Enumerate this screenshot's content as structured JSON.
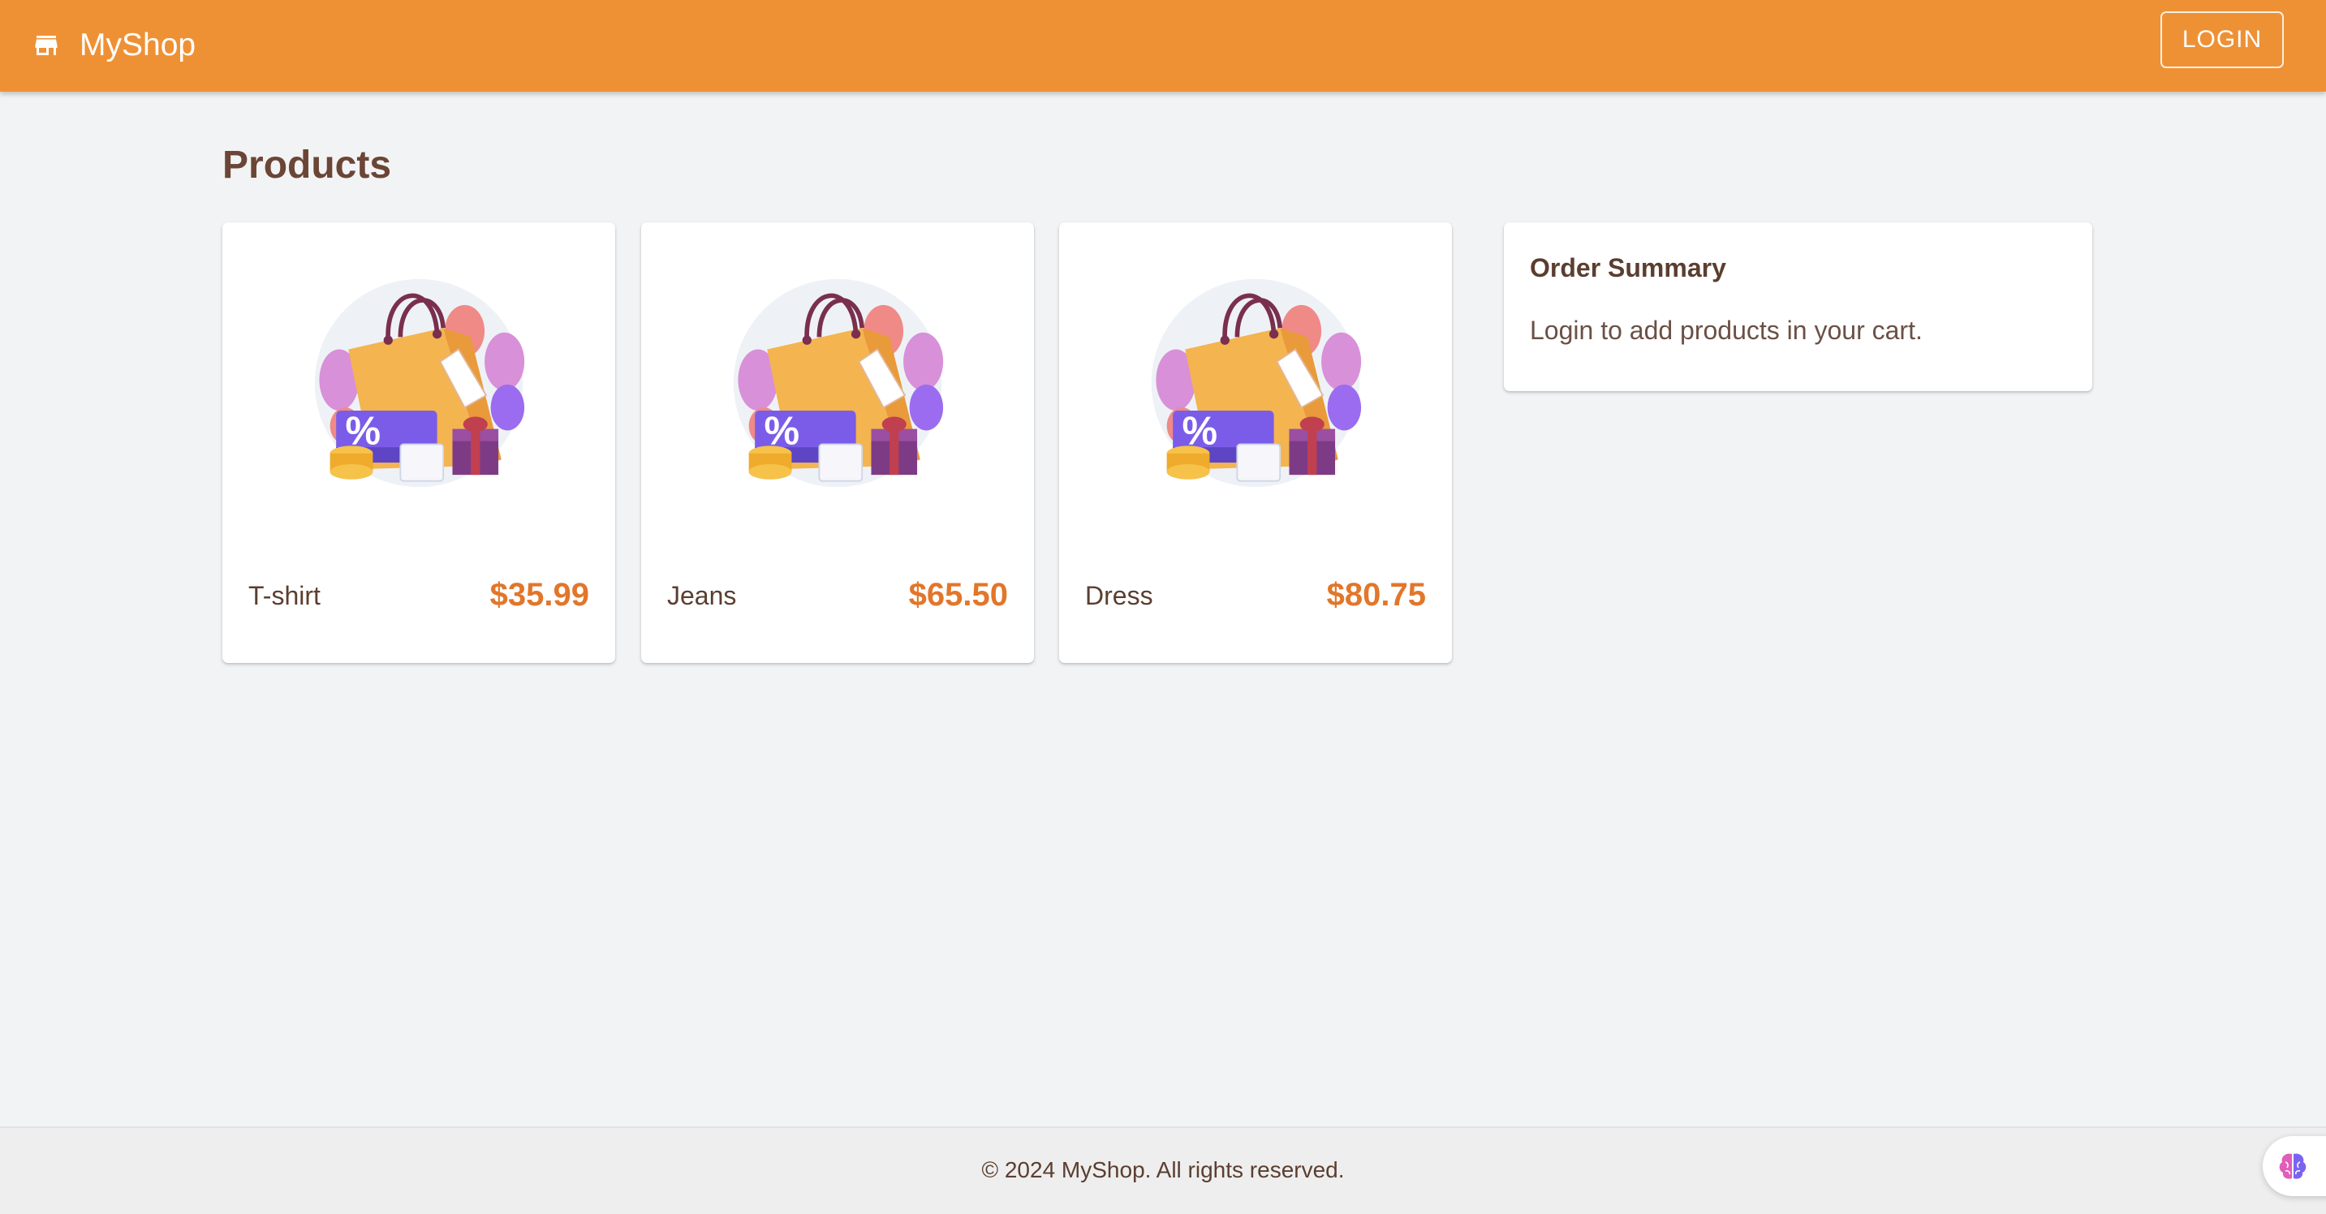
{
  "header": {
    "brand_icon": "storefront-icon",
    "brand_name": "MyShop",
    "login_label": "LOGIN",
    "background_color": "#ee9135"
  },
  "main": {
    "title": "Products",
    "products": [
      {
        "name": "T-shirt",
        "price": "$35.99",
        "image_icon": "shopping-bag-illustration"
      },
      {
        "name": "Jeans",
        "price": "$65.50",
        "image_icon": "shopping-bag-illustration"
      },
      {
        "name": "Dress",
        "price": "$80.75",
        "image_icon": "shopping-bag-illustration"
      }
    ],
    "price_color": "#e2762a"
  },
  "order_summary": {
    "title": "Order Summary",
    "message": "Login to add products in your cart."
  },
  "footer": {
    "text": "© 2024 MyShop. All rights reserved."
  },
  "extension_button": {
    "icon": "brain-icon"
  }
}
